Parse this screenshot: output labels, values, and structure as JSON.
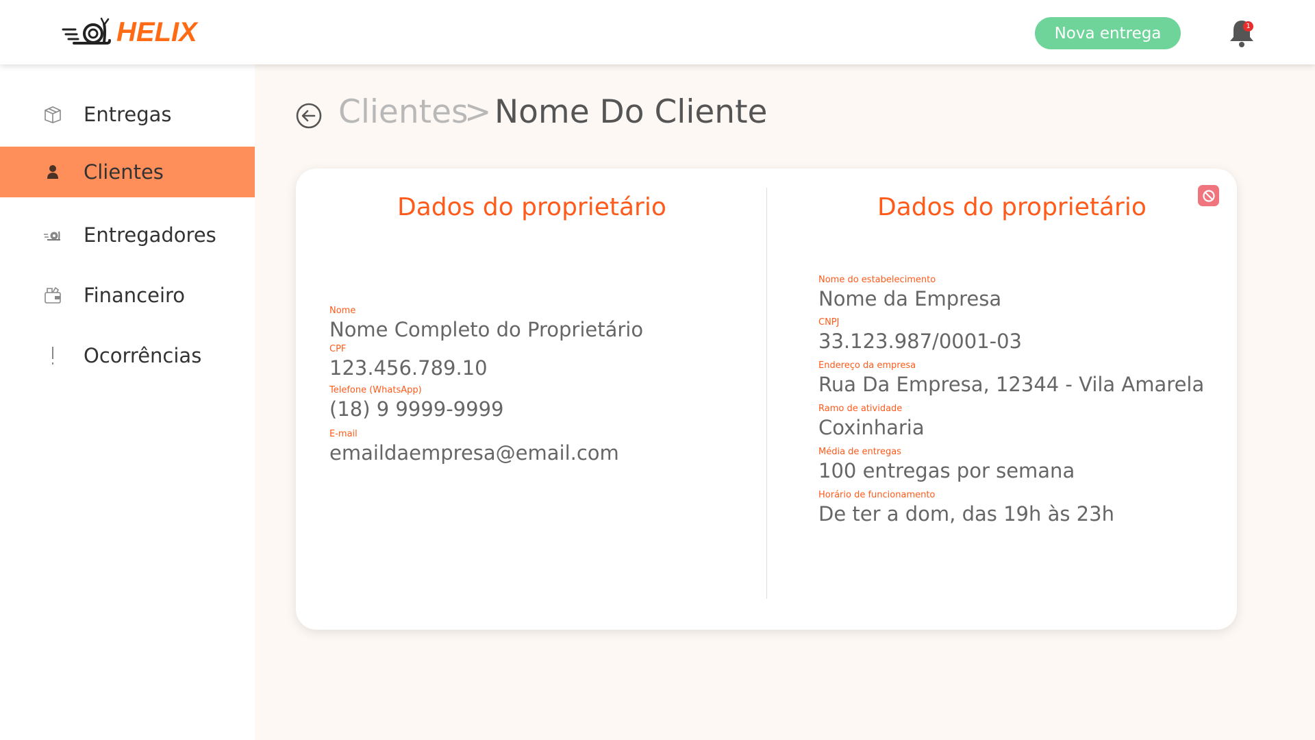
{
  "header": {
    "logo_text": "HELIX",
    "new_delivery_label": "Nova entrega",
    "notification_count": "1"
  },
  "sidebar": {
    "items": [
      {
        "label": "Entregas",
        "icon": "box-icon",
        "active": false
      },
      {
        "label": "Clientes",
        "icon": "person-icon",
        "active": true
      },
      {
        "label": "Entregadores",
        "icon": "snail-icon",
        "active": false
      },
      {
        "label": "Financeiro",
        "icon": "wallet-icon",
        "active": false
      },
      {
        "label": "Ocorrências",
        "icon": "exclamation-icon",
        "active": false
      }
    ]
  },
  "breadcrumb": {
    "parent": "Clientes",
    "separator": ">",
    "current": "Nome Do Cliente"
  },
  "card": {
    "left_title": "Dados do proprietário",
    "right_title": "Dados do proprietário",
    "owner": {
      "name_label": "Nome",
      "name_value": "Nome Completo do Proprietário",
      "cpf_label": "CPF",
      "cpf_value": "123.456.789.10",
      "phone_label": "Telefone (WhatsApp)",
      "phone_value": "(18) 9 9999-9999",
      "email_label": "E-mail",
      "email_value": "emaildaempresa@email.com"
    },
    "company": {
      "name_label": "Nome do estabelecimento",
      "name_value": "Nome da Empresa",
      "cnpj_label": "CNPJ",
      "cnpj_value": "33.123.987/0001-03",
      "address_label": "Endereço da empresa",
      "address_value": "Rua Da Empresa, 12344 - Vila Amarela",
      "activity_label": "Ramo de atividade",
      "activity_value": "Coxinharia",
      "deliveries_label": "Média de entregas",
      "deliveries_value": "100 entregas por semana",
      "hours_label": "Horário de funcionamento",
      "hours_value": "De ter a dom, das 19h às 23h"
    }
  },
  "colors": {
    "accent": "#ff5a1a",
    "sidebar_active": "#ff8f5a",
    "primary_button": "#6ed49a",
    "block_button": "#f0747e"
  }
}
